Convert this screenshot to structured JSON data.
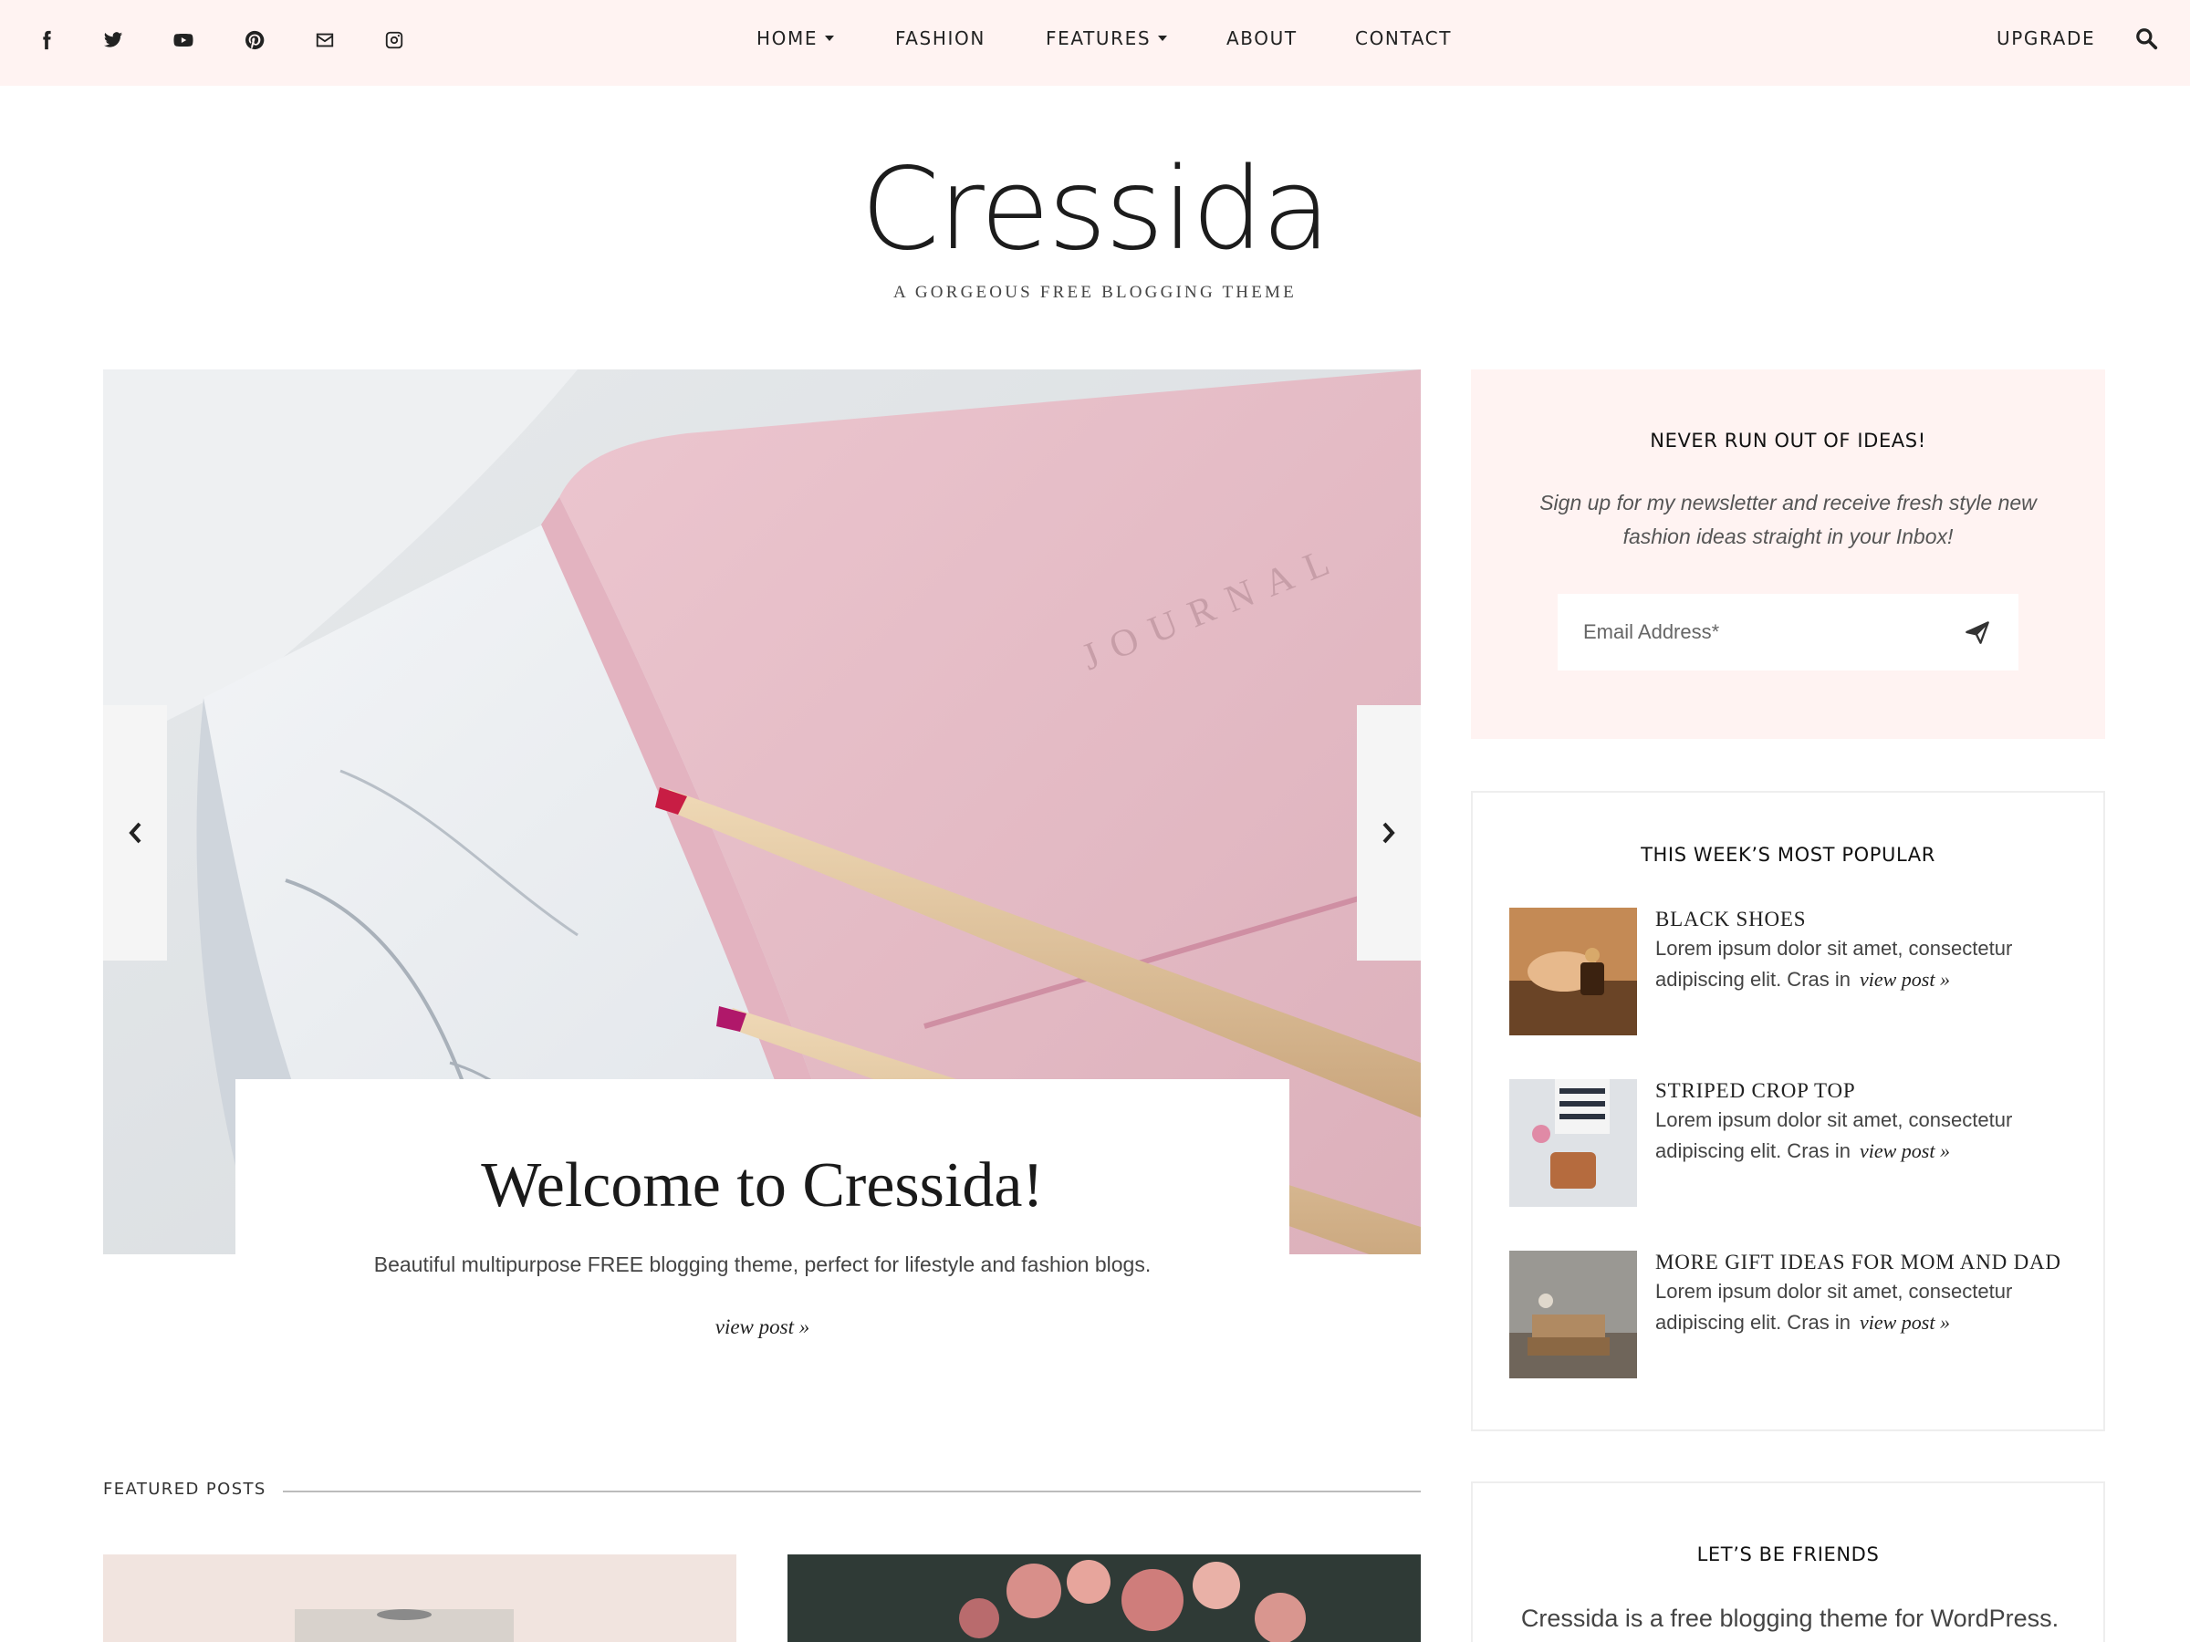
{
  "social": [
    {
      "icon": "facebook-icon"
    },
    {
      "icon": "twitter-icon"
    },
    {
      "icon": "youtube-icon"
    },
    {
      "icon": "pinterest-icon"
    },
    {
      "icon": "email-icon"
    },
    {
      "icon": "instagram-icon"
    }
  ],
  "nav": {
    "home": "HOME",
    "fashion": "FASHION",
    "features": "FEATURES",
    "about": "ABOUT",
    "contact": "CONTACT",
    "upgrade": "UPGRADE"
  },
  "site": {
    "name": "Cressida",
    "tagline": "A GORGEOUS FREE BLOGGING THEME"
  },
  "slider": {
    "title": "Welcome to Cressida!",
    "excerpt": "Beautiful multipurpose FREE blogging theme, perfect for lifestyle and fashion blogs.",
    "link": "view post »",
    "image_text": "JOURNAL"
  },
  "featured": {
    "label": "FEATURED POSTS"
  },
  "newsletter": {
    "title": "NEVER RUN OUT OF IDEAS!",
    "text": "Sign up for my newsletter and receive fresh style new fashion ideas straight in your Inbox!",
    "placeholder": "Email Address*"
  },
  "popular": {
    "title": "THIS WEEK’S MOST POPULAR",
    "items": [
      {
        "title": "BLACK SHOES",
        "excerpt": "Lorem ipsum dolor sit amet, consectetur adipiscing elit. Cras in",
        "link": "view post »"
      },
      {
        "title": "STRIPED CROP TOP",
        "excerpt": "Lorem ipsum dolor sit amet, consectetur adipiscing elit. Cras in",
        "link": "view post »"
      },
      {
        "title": "MORE GIFT IDEAS FOR MOM AND DAD",
        "excerpt": "Lorem ipsum dolor sit amet, consectetur adipiscing elit. Cras in",
        "link": "view post »"
      }
    ]
  },
  "friends": {
    "title": "LET’S BE FRIENDS",
    "text": "Cressida is a free blogging theme for WordPress."
  },
  "colors": {
    "topbar_bg": "#fff3f2",
    "widget_bg": "#fff3f2",
    "text_dark": "#222222"
  }
}
